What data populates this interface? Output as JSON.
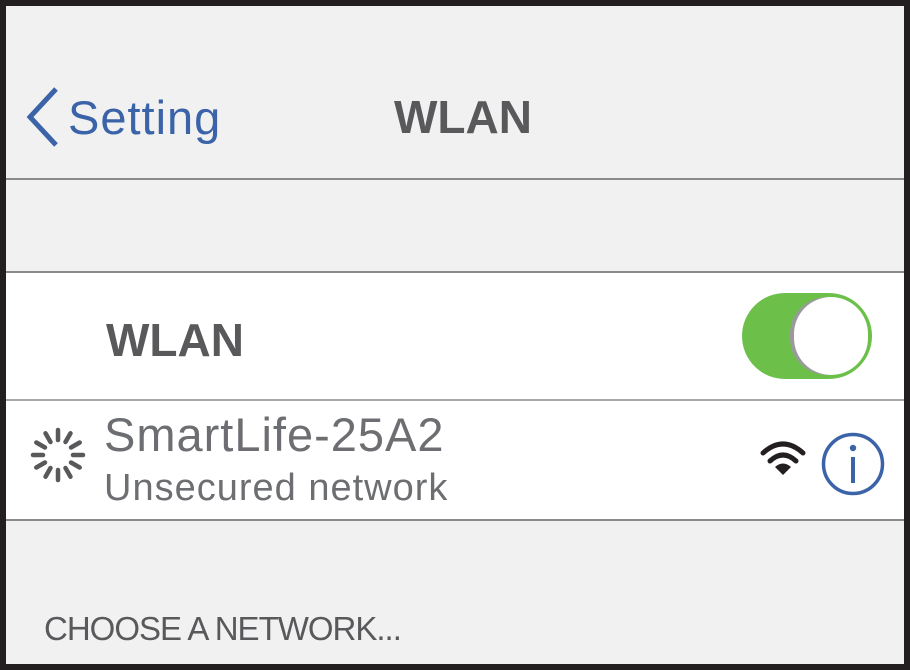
{
  "nav": {
    "back_label": "Setting",
    "title": "WLAN"
  },
  "wlan_toggle": {
    "label": "WLAN",
    "state": "on",
    "on_color": "#6cc04a"
  },
  "network": {
    "name": "SmartLife-25A2",
    "status": "Unsecured network",
    "connecting_icon": "spinner-icon",
    "signal_icon": "wifi-icon",
    "info_icon": "info-icon"
  },
  "section": {
    "header": "CHOOSE A NETWORK..."
  },
  "colors": {
    "accent": "#3b63a8",
    "text": "#59595b",
    "background": "#f1f1f2"
  }
}
